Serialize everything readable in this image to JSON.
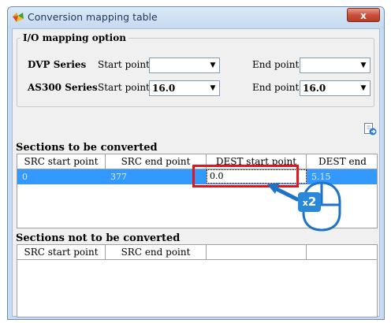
{
  "window": {
    "title": "Conversion mapping table",
    "close_label": "x"
  },
  "io_option": {
    "legend": "I/O mapping option",
    "dvp": {
      "label": "DVP Series",
      "start_label": "Start point",
      "start_value": "",
      "end_label": "End point",
      "end_value": ""
    },
    "as300": {
      "label": "AS300 Series",
      "start_label": "Start point",
      "start_value": "16.0",
      "end_label": "End point",
      "end_value": "16.0"
    }
  },
  "converted": {
    "title": "Sections to be converted",
    "columns": [
      "SRC start point",
      "SRC end point",
      "DEST start point",
      "DEST end point"
    ],
    "row": {
      "src_start": "0",
      "src_end": "377",
      "dest_start": "0.0",
      "dest_end": "5.15"
    }
  },
  "not_converted": {
    "title": "Sections not to be converted",
    "columns": [
      "SRC start point",
      "SRC end point",
      "",
      ""
    ]
  },
  "overlay": {
    "multiplier_prefix": "x",
    "multiplier_count": "2"
  },
  "icons": {
    "app": "conversion-app-icon",
    "add": "add-row-icon",
    "pointer": "pointer-arrow-icon",
    "mouse": "mouse-icon"
  },
  "colors": {
    "selection": "#3399ff",
    "highlight": "#e0161c",
    "accent": "#2a88d8"
  }
}
